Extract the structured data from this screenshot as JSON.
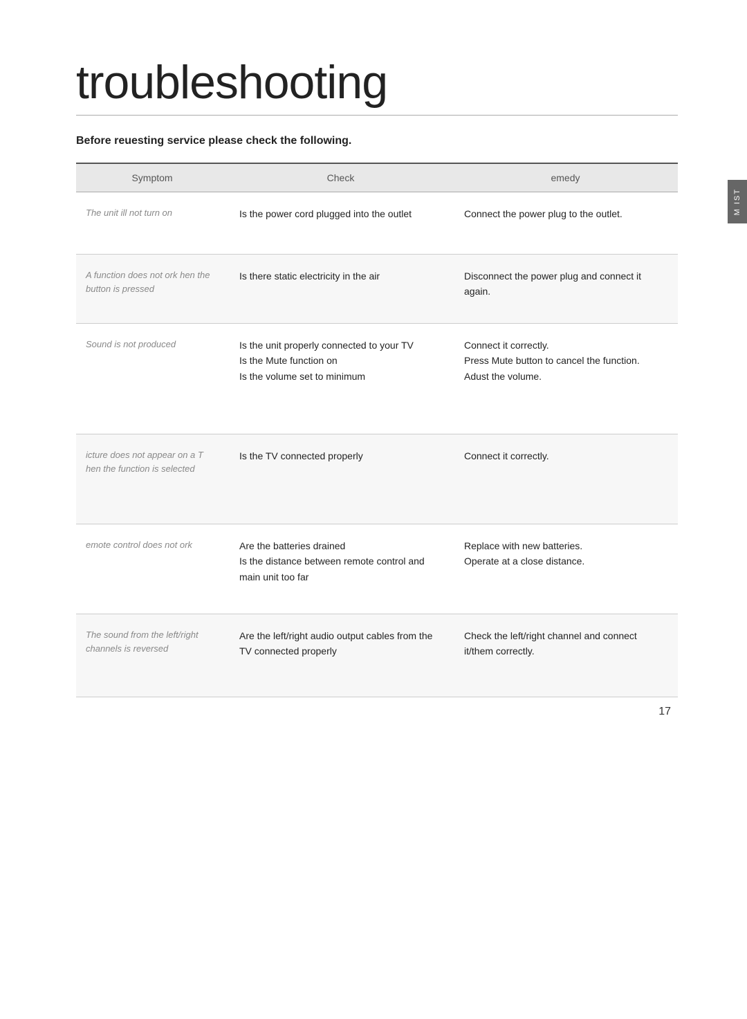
{
  "page": {
    "title": "troubleshooting",
    "subtitle": "Before reuesting service please check the following.",
    "page_number": "17",
    "side_tab_text": "M IST"
  },
  "table": {
    "headers": {
      "symptom": "Symptom",
      "check": "Check",
      "remedy": "emedy"
    },
    "rows": [
      {
        "symptom": "The unit ill  not turn on",
        "check": [
          "Is the power cord plugged into the outlet"
        ],
        "remedy": [
          "Connect the power plug to the outlet."
        ]
      },
      {
        "symptom": "A function  does not ork  hen the button  is pressed",
        "check": [
          "Is there static electricity in the air"
        ],
        "remedy": [
          "Disconnect the power plug and connect it again."
        ]
      },
      {
        "symptom": "Sound  is not produced",
        "check": [
          "Is the unit properly connected to your TV",
          "Is the Mute function on",
          "Is the volume set to minimum"
        ],
        "remedy": [
          "Connect it correctly.",
          "Press Mute button to cancel the function.",
          "Adust the volume."
        ]
      },
      {
        "symptom": "icture  does not appear on a T hen  the function  is selected",
        "check": [
          "Is the TV connected properly"
        ],
        "remedy": [
          "Connect it correctly."
        ]
      },
      {
        "symptom": "emote  control  does not ork",
        "check": [
          "Are the batteries drained",
          "Is the distance between remote control and main unit too far"
        ],
        "remedy": [
          "Replace with new batteries.",
          "Operate at a close distance."
        ]
      },
      {
        "symptom": "The sound  from the left/right channels  is reversed",
        "check": [
          "Are the left/right audio output cables from the TV connected properly"
        ],
        "remedy": [
          "Check the  left/right channel and connect it/them correctly."
        ]
      }
    ]
  }
}
